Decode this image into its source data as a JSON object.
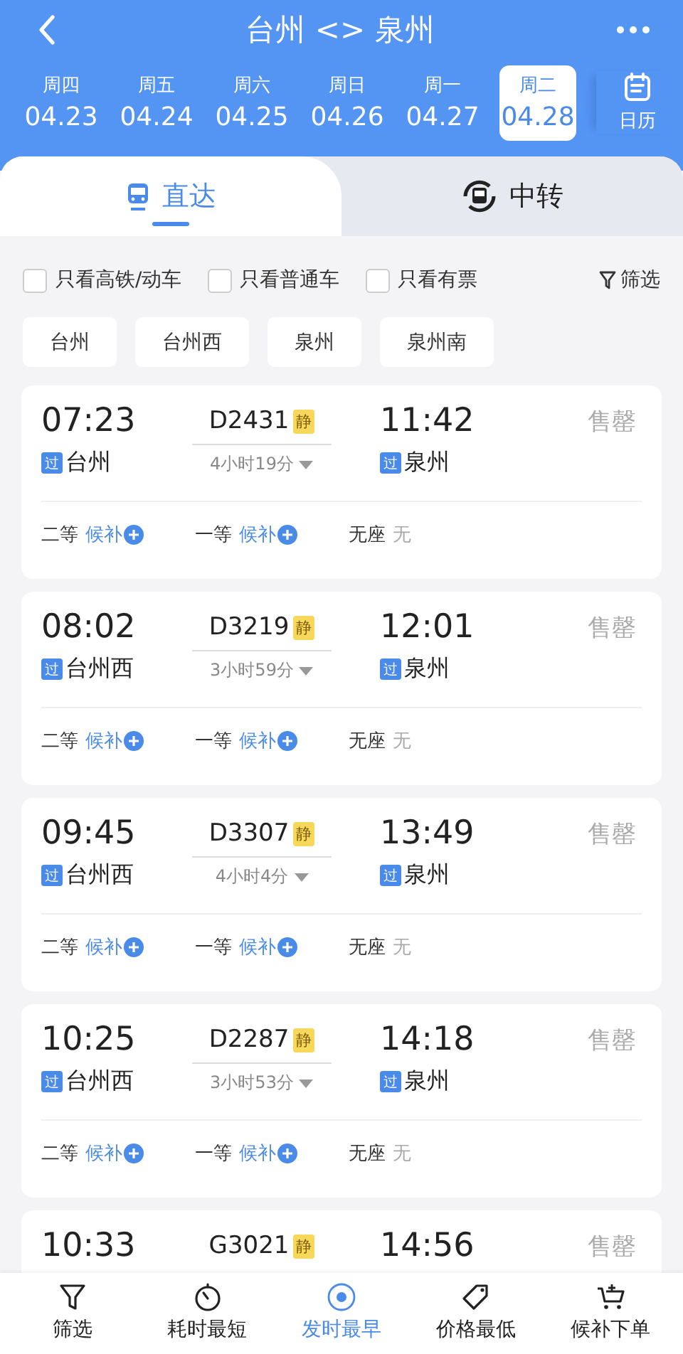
{
  "header": {
    "title": "台州 <> 泉州"
  },
  "dates": [
    {
      "weekday": "周四",
      "date": "04.23",
      "selected": false
    },
    {
      "weekday": "周五",
      "date": "04.24",
      "selected": false
    },
    {
      "weekday": "周六",
      "date": "04.25",
      "selected": false
    },
    {
      "weekday": "周日",
      "date": "04.26",
      "selected": false
    },
    {
      "weekday": "周一",
      "date": "04.27",
      "selected": false
    },
    {
      "weekday": "周二",
      "date": "04.28",
      "selected": true
    }
  ],
  "calendar": {
    "label": "日历"
  },
  "tabs": [
    {
      "label": "直达",
      "kind": "direct",
      "selected": true
    },
    {
      "label": "中转",
      "kind": "transfer",
      "selected": false
    }
  ],
  "filters": [
    {
      "label": "只看高铁/动车",
      "checked": false
    },
    {
      "label": "只看普通车",
      "checked": false
    },
    {
      "label": "只看有票",
      "checked": false
    }
  ],
  "filter_button": {
    "label": "筛选"
  },
  "stations": [
    {
      "label": "台州",
      "selected": false
    },
    {
      "label": "台州西",
      "selected": false
    },
    {
      "label": "泉州",
      "selected": false
    },
    {
      "label": "泉州南",
      "selected": false
    }
  ],
  "trains": [
    {
      "depart": "07:23",
      "train": "D2431",
      "tag": "静",
      "arrive": "11:42",
      "status": "售罄",
      "from_badge": "过",
      "from": "台州",
      "duration": "4小时19分",
      "to_badge": "过",
      "to": "泉州",
      "seats": [
        {
          "class": "二等",
          "avail": "候补",
          "kind": "waitlist"
        },
        {
          "class": "一等",
          "avail": "候补",
          "kind": "waitlist"
        },
        {
          "class": "无座",
          "avail": "无",
          "kind": "none"
        }
      ]
    },
    {
      "depart": "08:02",
      "train": "D3219",
      "tag": "静",
      "arrive": "12:01",
      "status": "售罄",
      "from_badge": "过",
      "from": "台州西",
      "duration": "3小时59分",
      "to_badge": "过",
      "to": "泉州",
      "seats": [
        {
          "class": "二等",
          "avail": "候补",
          "kind": "waitlist"
        },
        {
          "class": "一等",
          "avail": "候补",
          "kind": "waitlist"
        },
        {
          "class": "无座",
          "avail": "无",
          "kind": "none"
        }
      ]
    },
    {
      "depart": "09:45",
      "train": "D3307",
      "tag": "静",
      "arrive": "13:49",
      "status": "售罄",
      "from_badge": "过",
      "from": "台州西",
      "duration": "4小时4分",
      "to_badge": "过",
      "to": "泉州",
      "seats": [
        {
          "class": "二等",
          "avail": "候补",
          "kind": "waitlist"
        },
        {
          "class": "一等",
          "avail": "候补",
          "kind": "waitlist"
        },
        {
          "class": "无座",
          "avail": "无",
          "kind": "none"
        }
      ]
    },
    {
      "depart": "10:25",
      "train": "D2287",
      "tag": "静",
      "arrive": "14:18",
      "status": "售罄",
      "from_badge": "过",
      "from": "台州西",
      "duration": "3小时53分",
      "to_badge": "过",
      "to": "泉州",
      "seats": [
        {
          "class": "二等",
          "avail": "候补",
          "kind": "waitlist"
        },
        {
          "class": "一等",
          "avail": "候补",
          "kind": "waitlist"
        },
        {
          "class": "无座",
          "avail": "无",
          "kind": "none"
        }
      ]
    },
    {
      "depart": "10:33",
      "train": "G3021",
      "tag": "静",
      "arrive": "14:56",
      "status": "售罄"
    }
  ],
  "bottom_bar": [
    {
      "label": "筛选",
      "kind": "filter",
      "selected": false
    },
    {
      "label": "耗时最短",
      "kind": "timer",
      "selected": false
    },
    {
      "label": "发时最早",
      "kind": "clock24",
      "selected": true
    },
    {
      "label": "价格最低",
      "kind": "tag",
      "selected": false
    },
    {
      "label": "候补下单",
      "kind": "cart",
      "selected": false
    }
  ]
}
